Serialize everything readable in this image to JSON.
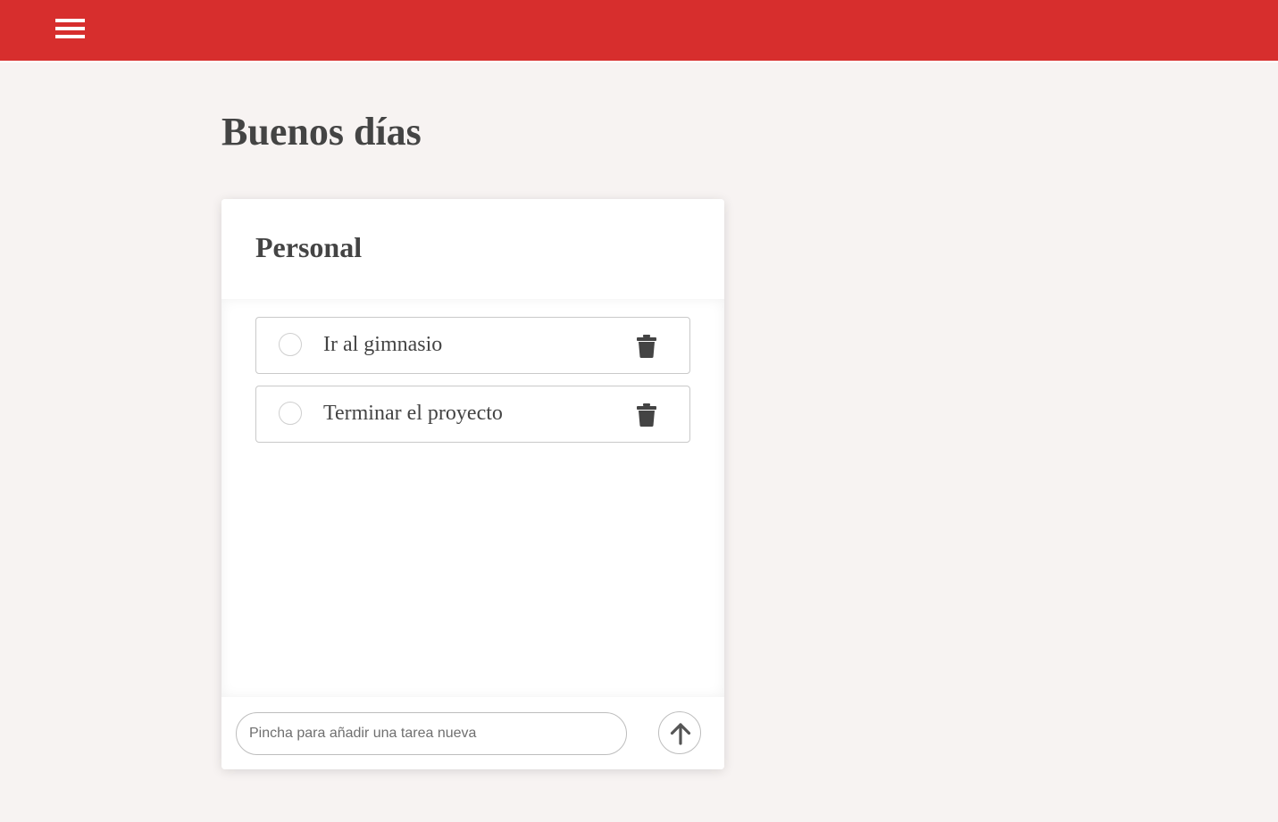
{
  "header": {
    "menu_icon": "hamburger-menu-icon",
    "accent_color": "#d72e2d"
  },
  "greeting": "Buenos días",
  "list": {
    "title": "Personal",
    "tasks": [
      {
        "label": "Ir al gimnasio",
        "done": false,
        "delete_icon": "trash-icon"
      },
      {
        "label": "Terminar el proyecto",
        "done": false,
        "delete_icon": "trash-icon"
      }
    ]
  },
  "new_task": {
    "value": "",
    "placeholder": "Pincha para añadir una tarea nueva",
    "submit_icon": "arrow-up-icon"
  }
}
